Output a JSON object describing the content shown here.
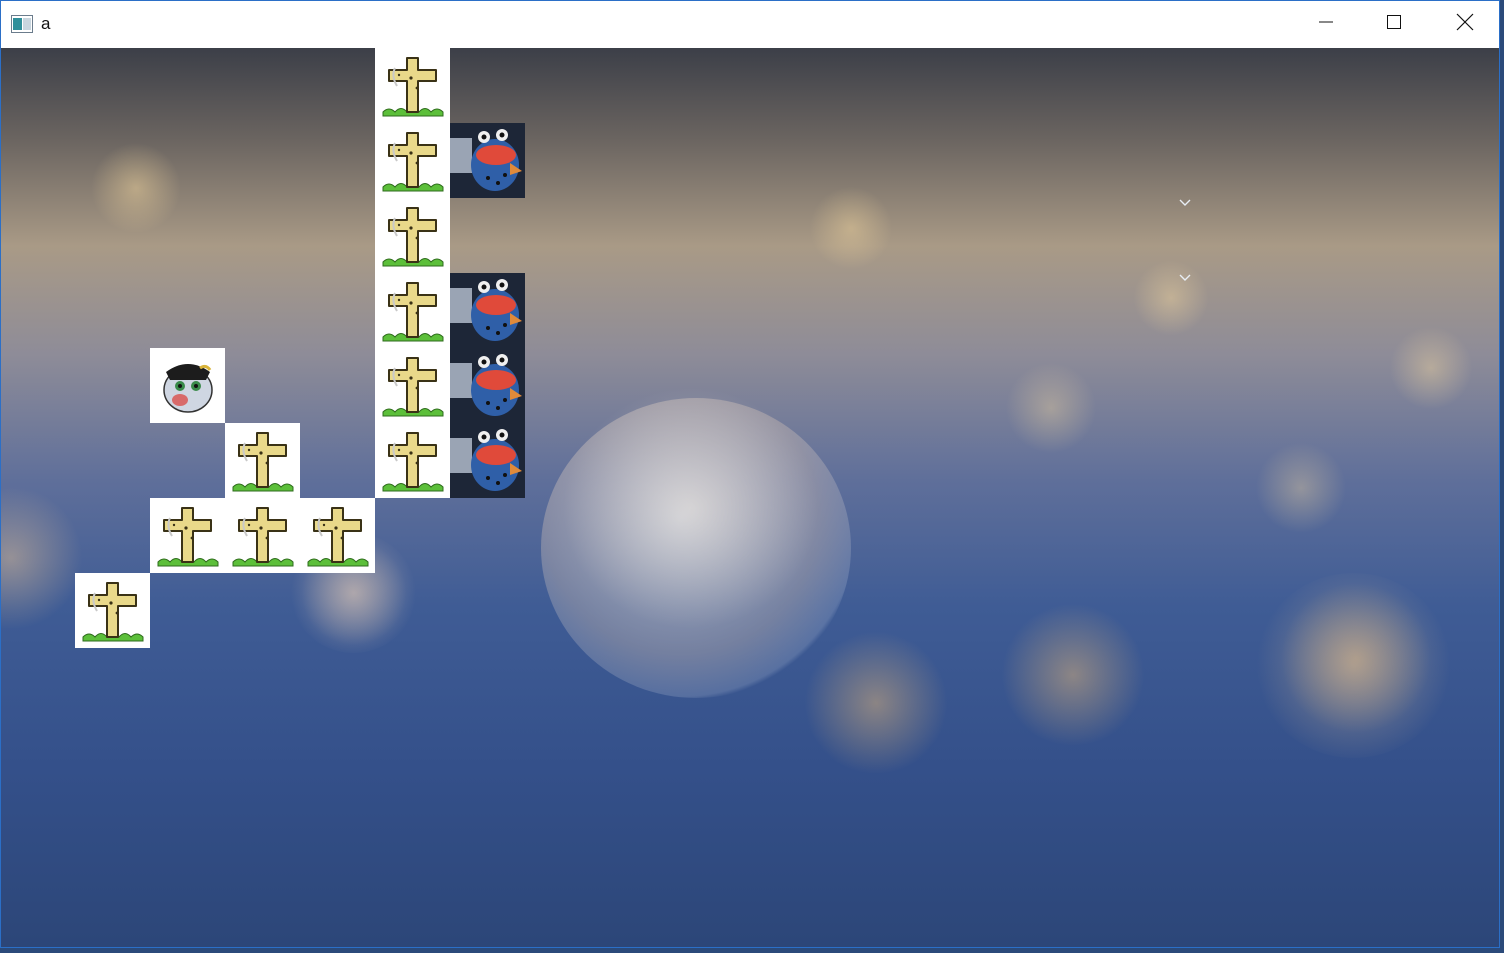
{
  "window": {
    "title": "a",
    "icons": {
      "app": "app-icon",
      "minimize": "minimize-icon",
      "maximize": "maximize-icon",
      "close": "close-icon"
    }
  },
  "scene": {
    "background": "frozen-bubbles-on-snow",
    "tiles": [
      {
        "kind": "grave",
        "col": 5,
        "row": 0
      },
      {
        "kind": "grave",
        "col": 5,
        "row": 1
      },
      {
        "kind": "frog",
        "col": 6,
        "row": 1
      },
      {
        "kind": "grave",
        "col": 5,
        "row": 2
      },
      {
        "kind": "grave",
        "col": 5,
        "row": 3
      },
      {
        "kind": "frog",
        "col": 6,
        "row": 3
      },
      {
        "kind": "grave",
        "col": 5,
        "row": 4
      },
      {
        "kind": "frog",
        "col": 6,
        "row": 4
      },
      {
        "kind": "zombie",
        "col": 2,
        "row": 4
      },
      {
        "kind": "grave",
        "col": 3,
        "row": 5
      },
      {
        "kind": "grave",
        "col": 5,
        "row": 5
      },
      {
        "kind": "frog",
        "col": 6,
        "row": 5
      },
      {
        "kind": "grave",
        "col": 2,
        "row": 6
      },
      {
        "kind": "grave",
        "col": 3,
        "row": 6
      },
      {
        "kind": "grave",
        "col": 4,
        "row": 6
      },
      {
        "kind": "grave",
        "col": 1,
        "row": 7
      }
    ],
    "markers": [
      {
        "name": "chevron-down-icon",
        "col": 15.7,
        "row": 1
      },
      {
        "name": "chevron-down-icon",
        "col": 15.7,
        "row": 2
      }
    ]
  }
}
